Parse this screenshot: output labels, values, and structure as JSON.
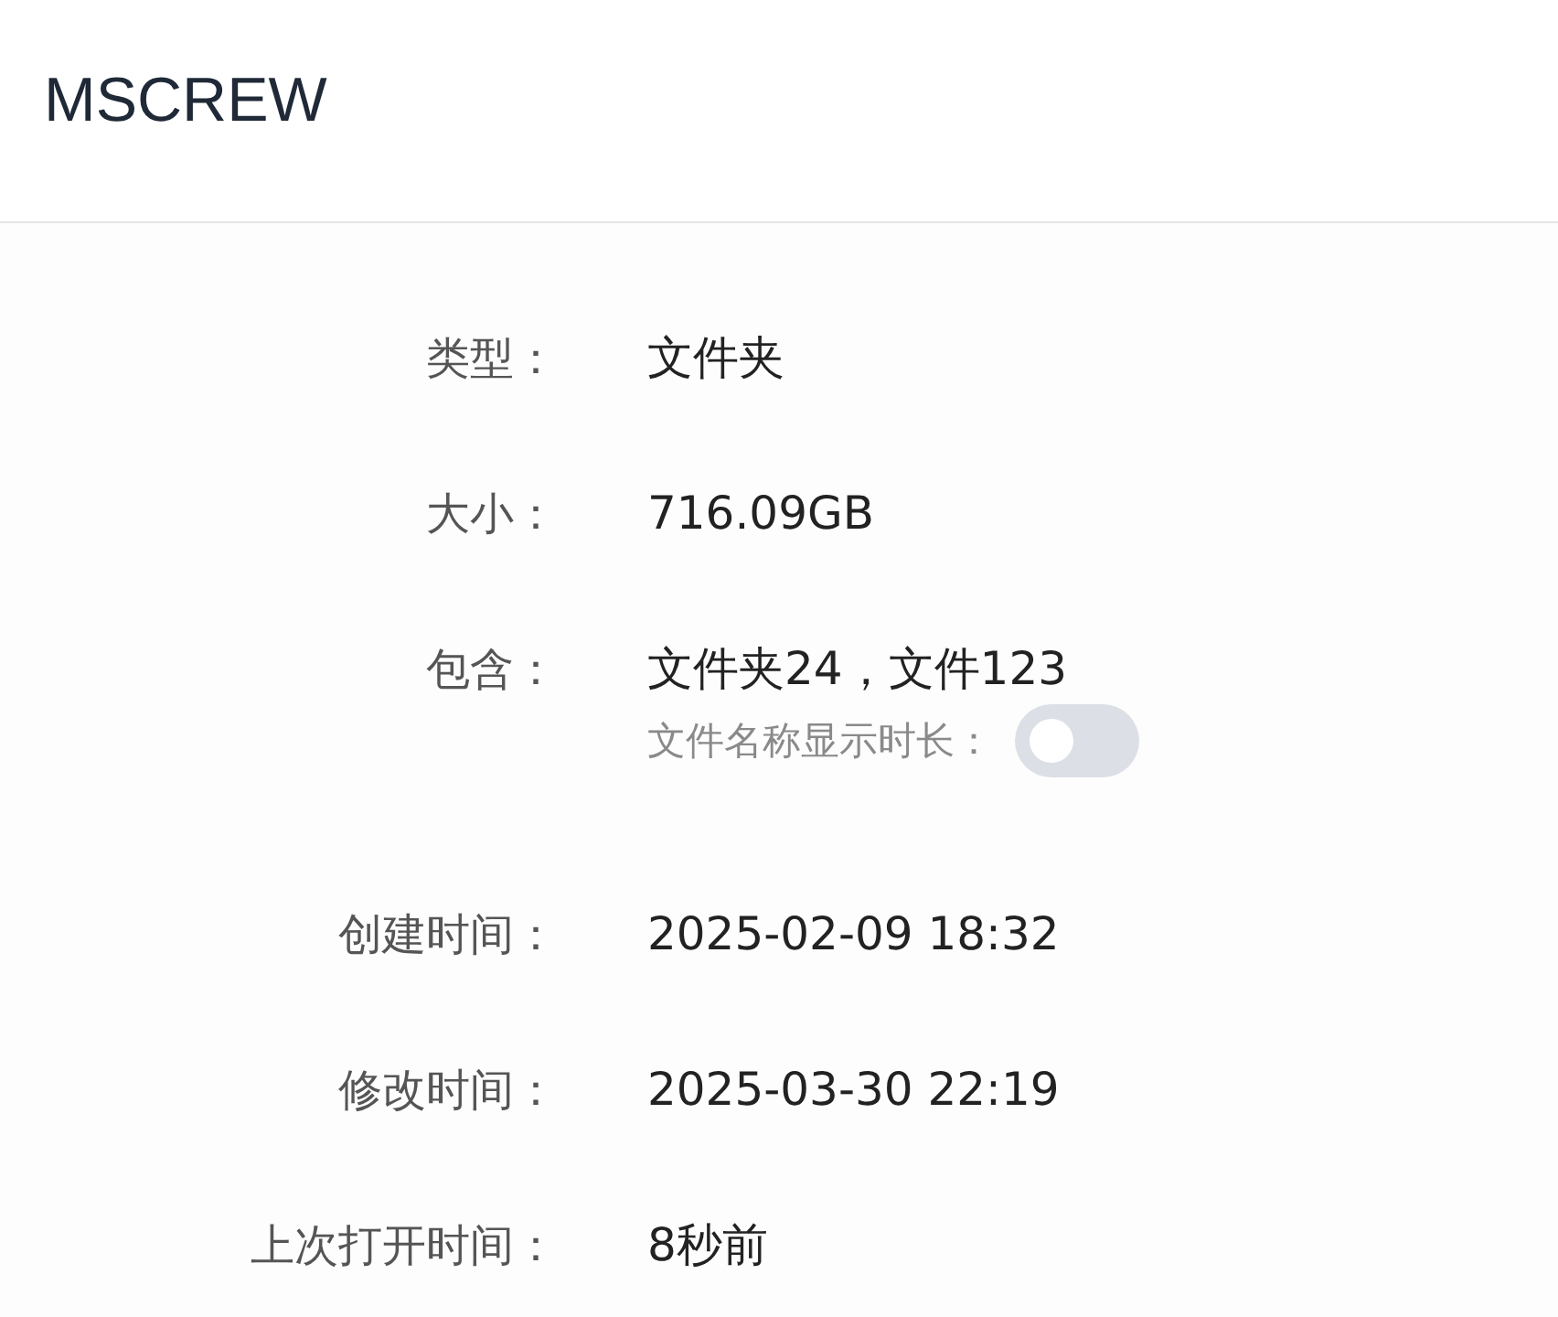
{
  "header": {
    "title": "MSCREW"
  },
  "details": [
    {
      "kind": "field",
      "label": "类型：",
      "value": "文件夹"
    },
    {
      "kind": "field",
      "label": "大小：",
      "value": "716.09GB"
    },
    {
      "kind": "field",
      "label": "包含：",
      "value": "文件夹24，文件123"
    },
    {
      "kind": "toggle",
      "label": "文件名称显示时长：",
      "on": false
    },
    {
      "kind": "field",
      "label": "创建时间：",
      "value": "2025-02-09 18:32"
    },
    {
      "kind": "field",
      "label": "修改时间：",
      "value": "2025-03-30 22:19"
    },
    {
      "kind": "field",
      "label": "上次打开时间：",
      "value": "8秒前"
    }
  ]
}
